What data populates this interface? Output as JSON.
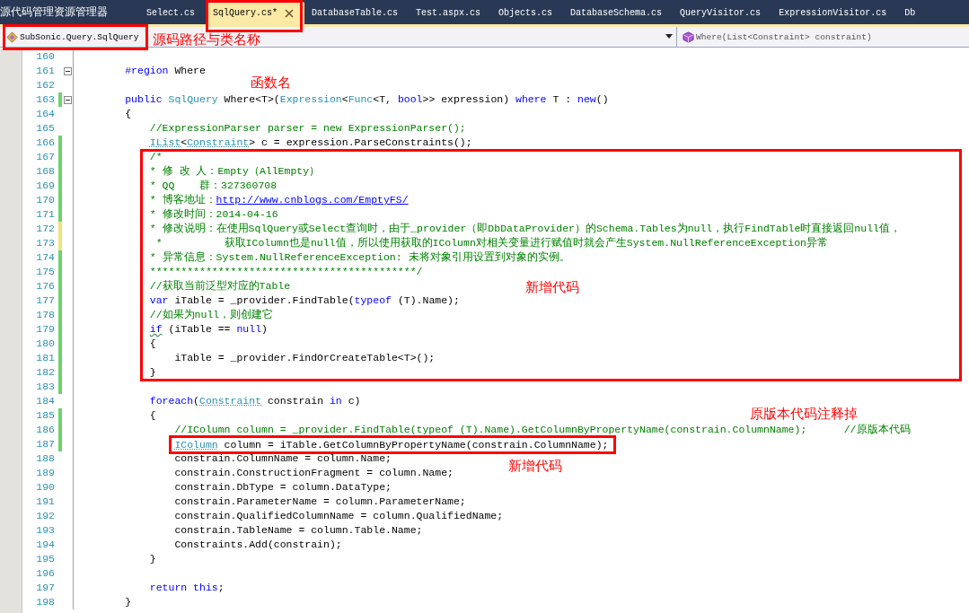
{
  "tool_tab": {
    "label": "源代码管理资源管理器"
  },
  "tabs": [
    {
      "label": "Select.cs",
      "selected": false
    },
    {
      "label": "SqlQuery.cs*",
      "selected": true
    },
    {
      "label": "DatabaseTable.cs",
      "selected": false
    },
    {
      "label": "Test.aspx.cs",
      "selected": false
    },
    {
      "label": "Objects.cs",
      "selected": false
    },
    {
      "label": "DatabaseSchema.cs",
      "selected": false
    },
    {
      "label": "QueryVisitor.cs",
      "selected": false
    },
    {
      "label": "ExpressionVisitor.cs",
      "selected": false
    },
    {
      "label": "Db",
      "selected": false
    }
  ],
  "nav": {
    "class_dropdown": "SubSonic.Query.SqlQuery",
    "member_dropdown": "Where(List<Constraint> constraint)"
  },
  "lines": [
    {
      "number": "160"
    },
    {
      "number": "161",
      "expanded": true,
      "tokens": [
        {
          "kind": "kw",
          "t": "        #region"
        },
        {
          "kind": "tx",
          "t": " Where"
        }
      ]
    },
    {
      "number": "162"
    },
    {
      "number": "163",
      "expanded": true,
      "change_marker": {
        "color": "#6cd36c"
      },
      "tokens": [
        {
          "kind": "kw",
          "t": "        public "
        },
        {
          "kind": "type",
          "t": "SqlQuery"
        },
        {
          "kind": "tx",
          "t": " Where<T>("
        },
        {
          "kind": "type",
          "t": "Expression"
        },
        {
          "kind": "tx",
          "t": "<"
        },
        {
          "kind": "type",
          "t": "Func"
        },
        {
          "kind": "tx",
          "t": "<T, "
        },
        {
          "kind": "kw",
          "t": "bool"
        },
        {
          "kind": "tx",
          "t": ">> expression) "
        },
        {
          "kind": "kw",
          "t": "where"
        },
        {
          "kind": "tx",
          "t": " T : "
        },
        {
          "kind": "kw",
          "t": "new"
        },
        {
          "kind": "tx",
          "t": "()"
        }
      ]
    },
    {
      "number": "164",
      "tokens": [
        {
          "kind": "tx",
          "t": "        {"
        }
      ]
    },
    {
      "number": "165",
      "tokens": [
        {
          "kind": "cm",
          "t": "            //ExpressionParser parser = new ExpressionParser();"
        }
      ]
    },
    {
      "number": "166",
      "change_marker": {
        "color": "#6cd36c"
      },
      "tokens": [
        {
          "kind": "type",
          "t": "            IList",
          "underlined": true
        },
        {
          "kind": "tx",
          "t": "<"
        },
        {
          "kind": "type",
          "t": "Constraint",
          "underlined": true
        },
        {
          "kind": "tx",
          "t": "> c = expression.ParseConstraints();"
        }
      ]
    },
    {
      "number": "167",
      "change_marker": {
        "color": "#6cd36c"
      },
      "tokens": [
        {
          "kind": "cm",
          "t": "            /*"
        }
      ]
    },
    {
      "number": "168",
      "change_marker": {
        "color": "#6cd36c"
      },
      "tokens": [
        {
          "kind": "cm",
          "t": "            * 修 改 人：Empty（AllEmpty）"
        }
      ]
    },
    {
      "number": "169",
      "change_marker": {
        "color": "#6cd36c"
      },
      "tokens": [
        {
          "kind": "cm",
          "t": "            * QQ    群：327360708"
        }
      ]
    },
    {
      "number": "170",
      "change_marker": {
        "color": "#6cd36c"
      },
      "tokens": [
        {
          "kind": "cm",
          "t": "            * 博客地址："
        },
        {
          "kind": "link",
          "t": "http://www.cnblogs.com/EmptyFS/"
        }
      ]
    },
    {
      "number": "171",
      "change_marker": {
        "color": "#6cd36c"
      },
      "tokens": [
        {
          "kind": "cm",
          "t": "            * 修改时间：2014-04-16"
        }
      ]
    },
    {
      "number": "172",
      "change_marker": {
        "color": "#f1e27a"
      },
      "tokens": [
        {
          "kind": "cm",
          "t": "            * 修改说明：在使用SqlQuery或Select查询时，由于_provider（即DbDataProvider）的Schema.Tables为null，执行FindTable时直接返回null值，"
        }
      ]
    },
    {
      "number": "173",
      "change_marker": {
        "color": "#f1e27a"
      },
      "tokens": [
        {
          "kind": "cm",
          "t": "             *          获取IColumn也是null值，所以使用获取的IColumn对相关变量进行赋值时就会产生System.NullReferenceException异常"
        }
      ]
    },
    {
      "number": "174",
      "change_marker": {
        "color": "#6cd36c"
      },
      "tokens": [
        {
          "kind": "cm",
          "t": "            * 异常信息：System.NullReferenceException: 未将对象引用设置到对象的实例。"
        }
      ]
    },
    {
      "number": "175",
      "change_marker": {
        "color": "#6cd36c"
      },
      "tokens": [
        {
          "kind": "cm",
          "t": "            *******************************************/"
        }
      ]
    },
    {
      "number": "176",
      "change_marker": {
        "color": "#6cd36c"
      },
      "tokens": [
        {
          "kind": "cm",
          "t": "            //获取当前泛型对应的Table"
        }
      ]
    },
    {
      "number": "177",
      "change_marker": {
        "color": "#6cd36c"
      },
      "tokens": [
        {
          "kind": "kw",
          "t": "            var"
        },
        {
          "kind": "tx",
          "t": " iTable = _provider.FindTable("
        },
        {
          "kind": "kw",
          "t": "typeof"
        },
        {
          "kind": "tx",
          "t": " (T).Name);"
        }
      ]
    },
    {
      "number": "178",
      "change_marker": {
        "color": "#6cd36c"
      },
      "tokens": [
        {
          "kind": "cm",
          "t": "            //如果为null，则创建它"
        }
      ]
    },
    {
      "number": "179",
      "change_marker": {
        "color": "#6cd36c"
      },
      "tokens": [
        {
          "kind": "kw",
          "t": "            if",
          "warning": true
        },
        {
          "kind": "tx",
          "t": " (iTable == "
        },
        {
          "kind": "kw",
          "t": "null"
        },
        {
          "kind": "tx",
          "t": ")"
        }
      ]
    },
    {
      "number": "180",
      "change_marker": {
        "color": "#6cd36c"
      },
      "tokens": [
        {
          "kind": "tx",
          "t": "            {"
        }
      ]
    },
    {
      "number": "181",
      "change_marker": {
        "color": "#6cd36c"
      },
      "tokens": [
        {
          "kind": "tx",
          "t": "                iTable = _provider.FindOrCreateTable<T>();"
        }
      ]
    },
    {
      "number": "182",
      "change_marker": {
        "color": "#6cd36c"
      },
      "tokens": [
        {
          "kind": "tx",
          "t": "            }"
        }
      ]
    },
    {
      "number": "183",
      "change_marker": {
        "color": "#6cd36c"
      }
    },
    {
      "number": "184",
      "tokens": [
        {
          "kind": "kw",
          "t": "            foreach"
        },
        {
          "kind": "tx",
          "t": "("
        },
        {
          "kind": "type",
          "t": "Constraint",
          "underlined": true
        },
        {
          "kind": "tx",
          "t": " constrain "
        },
        {
          "kind": "kw",
          "t": "in"
        },
        {
          "kind": "tx",
          "t": " c)"
        }
      ]
    },
    {
      "number": "185",
      "change_marker": {
        "color": "#6cd36c"
      },
      "tokens": [
        {
          "kind": "tx",
          "t": "            {"
        }
      ]
    },
    {
      "number": "186",
      "change_marker": {
        "color": "#6cd36c"
      },
      "tokens": [
        {
          "kind": "cm",
          "t": "                //IColumn column = _provider.FindTable(typeof (T).Name).GetColumnByPropertyName(constrain.ColumnName);      //原版本代码"
        }
      ]
    },
    {
      "number": "187",
      "change_marker": {
        "color": "#6cd36c"
      },
      "tokens": [
        {
          "kind": "type",
          "t": "                IColumn",
          "underlined": true
        },
        {
          "kind": "tx",
          "t": " column = iTable.GetColumnByPropertyName(constrain.ColumnName);"
        }
      ]
    },
    {
      "number": "188",
      "tokens": [
        {
          "kind": "tx",
          "t": "                constrain.ColumnName = column.Name;"
        }
      ]
    },
    {
      "number": "189",
      "tokens": [
        {
          "kind": "tx",
          "t": "                constrain.ConstructionFragment = column.Name;"
        }
      ]
    },
    {
      "number": "190",
      "tokens": [
        {
          "kind": "tx",
          "t": "                constrain.DbType = column.DataType;"
        }
      ]
    },
    {
      "number": "191",
      "tokens": [
        {
          "kind": "tx",
          "t": "                constrain.ParameterName = column.ParameterName;"
        }
      ]
    },
    {
      "number": "192",
      "tokens": [
        {
          "kind": "tx",
          "t": "                constrain.QualifiedColumnName = column.QualifiedName;"
        }
      ]
    },
    {
      "number": "193",
      "tokens": [
        {
          "kind": "tx",
          "t": "                constrain.TableName = column.Table.Name;"
        }
      ]
    },
    {
      "number": "194",
      "tokens": [
        {
          "kind": "tx",
          "t": "                Constraints.Add(constrain);"
        }
      ]
    },
    {
      "number": "195",
      "tokens": [
        {
          "kind": "tx",
          "t": "            }"
        }
      ]
    },
    {
      "number": "196"
    },
    {
      "number": "197",
      "tokens": [
        {
          "kind": "kw",
          "t": "            return "
        },
        {
          "kind": "kw",
          "t": "this"
        },
        {
          "kind": "tx",
          "t": ";"
        }
      ]
    },
    {
      "number": "198",
      "tokens": [
        {
          "kind": "tx",
          "t": "        }"
        }
      ]
    }
  ],
  "annotations": [
    {
      "kind": "box"
    },
    {
      "kind": "box"
    },
    {
      "kind": "box"
    },
    {
      "kind": "box"
    },
    {
      "kind": "label",
      "text": "源码路径与类名称"
    },
    {
      "kind": "label",
      "text": "函数名"
    },
    {
      "kind": "label",
      "text": "新增代码"
    },
    {
      "kind": "label",
      "text": "原版本代码注释掉"
    },
    {
      "kind": "label",
      "text": "新增代码"
    }
  ]
}
